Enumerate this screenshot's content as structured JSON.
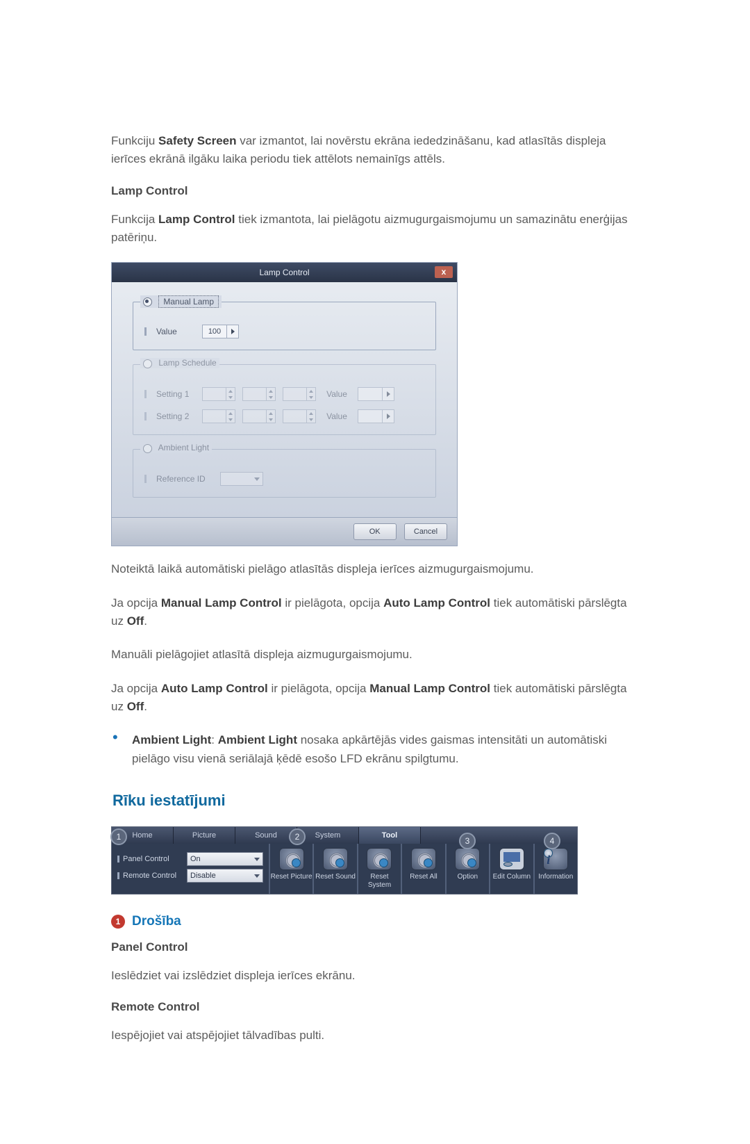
{
  "intro": {
    "safety_prefix": "Funkciju ",
    "safety_bold": "Safety Screen",
    "safety_suffix": " var izmantot, lai novērstu ekrāna iededzināšanu, kad atlasītās displeja ierīces ekrānā ilgāku laika periodu tiek attēlots nemainīgs attēls."
  },
  "lamp": {
    "heading": "Lamp Control",
    "sentence_prefix": "Funkcija ",
    "sentence_bold": "Lamp Control",
    "sentence_suffix": " tiek izmantota, lai pielāgotu aizmugurgaismojumu un samazinātu enerģijas patēriņu."
  },
  "dialog": {
    "title": "Lamp Control",
    "close": "x",
    "manual_lamp": "Manual Lamp",
    "value_label": "Value",
    "value": "100",
    "lamp_schedule": "Lamp Schedule",
    "setting1": "Setting 1",
    "setting2": "Setting 2",
    "schedule_value": "Value",
    "ambient_light": "Ambient Light",
    "reference_id": "Reference ID",
    "ok": "OK",
    "cancel": "Cancel"
  },
  "after": {
    "p1": "Noteiktā laikā automātiski pielāgo atlasītās displeja ierīces aizmugurgaismojumu.",
    "p2_a": "Ja opcija ",
    "p2_b1": "Manual Lamp Control",
    "p2_c": " ir pielāgota, opcija ",
    "p2_b2": "Auto Lamp Control",
    "p2_d": " tiek automātiski pārslēgta uz ",
    "p2_off": "Off",
    "p3": "Manuāli pielāgojiet atlasītā displeja aizmugurgaismojumu.",
    "p4_a": "Ja opcija ",
    "p4_b1": "Auto Lamp Control",
    "p4_c": " ir pielāgota, opcija ",
    "p4_b2": "Manual Lamp Control",
    "p4_d": " tiek automātiski pārslēgta uz ",
    "p4_off": "Off",
    "bullet_b1": "Ambient Light",
    "bullet_sep": ": ",
    "bullet_b2": "Ambient Light",
    "bullet_txt": " nosaka apkārtējās vides gaismas intensitāti un automātiski pielāgo visu vienā seriālajā ķēdē esošo LFD ekrānu spilgtumu."
  },
  "tools": {
    "heading": "Rīku iestatījumi",
    "tabs": [
      "Home",
      "Picture",
      "Sound",
      "System",
      "Tool"
    ],
    "markers": [
      "1",
      "2",
      "3",
      "4"
    ],
    "panel_control": "Panel Control",
    "panel_value": "On",
    "remote_control": "Remote Control",
    "remote_value": "Disable",
    "icons": [
      "Reset Picture",
      "Reset Sound",
      "Reset System",
      "Reset All",
      "Option",
      "Edit Column",
      "Information"
    ]
  },
  "section1": {
    "num": "1",
    "title": "Drošība",
    "panel_h": "Panel Control",
    "panel_txt": "Ieslēdziet vai izslēdziet displeja ierīces ekrānu.",
    "remote_h": "Remote Control",
    "remote_txt": "Iespējojiet vai atspējojiet tālvadības pulti."
  }
}
